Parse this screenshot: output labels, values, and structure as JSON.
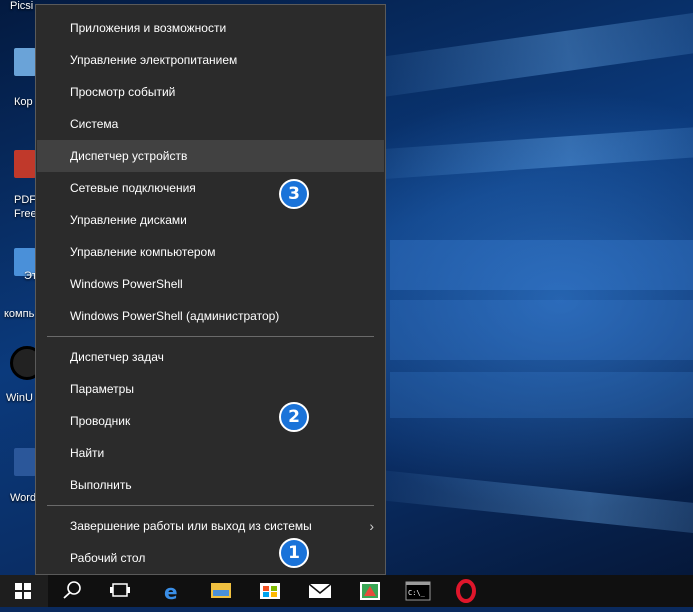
{
  "desktop": {
    "top_label": "Picsi",
    "icons": [
      {
        "label": "Кор",
        "color": "#6aa3d8"
      },
      {
        "label": "PDF",
        "label2": "Free",
        "color": "#c0392b"
      },
      {
        "label": "Эт",
        "label2": "компь",
        "color": "#4a90d9"
      },
      {
        "label": "WinU",
        "color": "#111111"
      },
      {
        "label": "Word",
        "color": "#2b579a"
      }
    ]
  },
  "menu": {
    "items": [
      {
        "label": "Приложения и возможности"
      },
      {
        "label": "Управление электропитанием"
      },
      {
        "label": "Просмотр событий"
      },
      {
        "label": "Система"
      },
      {
        "label": "Диспетчер устройств",
        "highlighted": true
      },
      {
        "label": "Сетевые подключения"
      },
      {
        "label": "Управление дисками"
      },
      {
        "label": "Управление компьютером"
      },
      {
        "label": "Windows PowerShell"
      },
      {
        "label": "Windows PowerShell (администратор)"
      },
      {
        "label": "Диспетчер задач"
      },
      {
        "label": "Параметры"
      },
      {
        "label": "Проводник"
      },
      {
        "label": "Найти"
      },
      {
        "label": "Выполнить"
      },
      {
        "label": "Завершение работы или выход из системы",
        "has_submenu": true
      },
      {
        "label": "Рабочий стол"
      }
    ],
    "submenu_arrow": "›"
  },
  "badges": [
    "3",
    "2",
    "1"
  ],
  "taskbar": {
    "icons": [
      "windows-start-icon",
      "search-icon",
      "task-view-icon",
      "edge-icon",
      "file-explorer-icon",
      "store-icon",
      "mail-icon",
      "app-icon",
      "command-prompt-icon",
      "opera-icon"
    ],
    "cmd_glyph": "C:\\_"
  },
  "colors": {
    "menu_bg": "#2b2b2b",
    "menu_highlight": "#414141",
    "badge": "#1a73d9",
    "taskbar": "#101010"
  }
}
